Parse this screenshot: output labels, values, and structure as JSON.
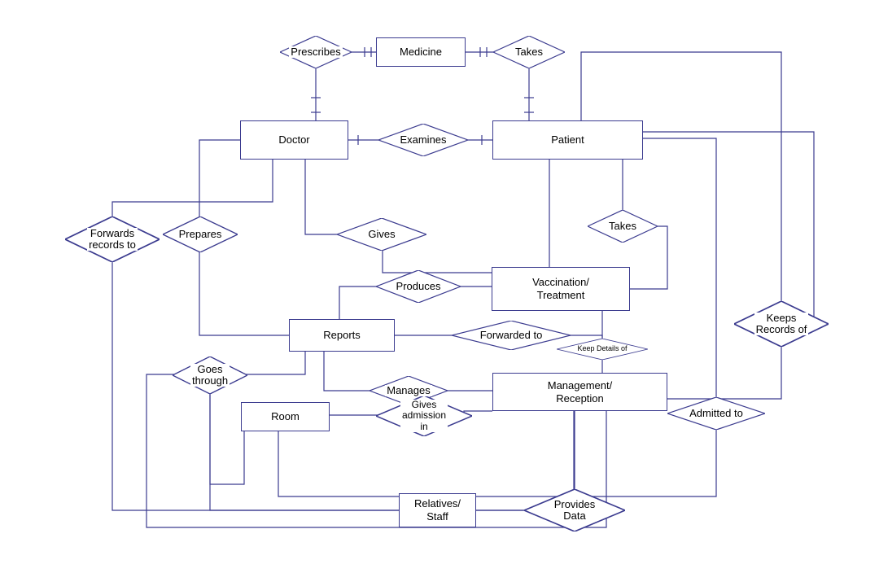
{
  "entities": {
    "medicine": "Medicine",
    "doctor": "Doctor",
    "patient": "Patient",
    "vaccination_treatment": "Vaccination/\nTreatment",
    "reports": "Reports",
    "management_reception": "Management/\nReception",
    "room": "Room",
    "relatives_staff": "Relatives/\nStaff"
  },
  "relationships": {
    "prescribes": "Prescribes",
    "takes_medicine": "Takes",
    "examines": "Examines",
    "gives": "Gives",
    "takes_vaccination": "Takes",
    "prepares": "Prepares",
    "forwards_records_to": "Forwards\nrecords to",
    "produces": "Produces",
    "forwarded_to": "Forwarded to",
    "keep_details_of": "Keep Details of",
    "goes_through": "Goes\nthrough",
    "manages": "Manages",
    "gives_admission_in": "Gives\nadmission\nin",
    "keeps_records_of": "Keeps\nRecords of",
    "admitted_to": "Admitted to",
    "provides_data": "Provides\nData"
  }
}
